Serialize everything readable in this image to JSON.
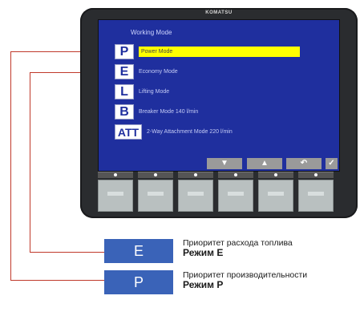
{
  "monitor": {
    "brand": "KOMATSU",
    "screen_title": "Working Mode",
    "modes": [
      {
        "key": "P",
        "label": "Power Mode",
        "selected": true
      },
      {
        "key": "E",
        "label": "Economy Mode",
        "selected": false
      },
      {
        "key": "L",
        "label": "Lifting Mode",
        "selected": false
      },
      {
        "key": "B",
        "label": "Breaker Mode  140 l/min",
        "selected": false
      },
      {
        "key": "ATT",
        "label": "2-Way Attachment Mode  220 l/min",
        "selected": false
      }
    ],
    "nav_buttons": [
      {
        "icon": "arrow-down-icon",
        "glyph": "▼"
      },
      {
        "icon": "arrow-up-icon",
        "glyph": "▲"
      },
      {
        "icon": "return-icon",
        "glyph": "↶"
      },
      {
        "icon": "confirm-icon",
        "glyph": "✓"
      }
    ]
  },
  "legend": {
    "economy": {
      "badge": "E",
      "subtitle": "Приоритет расхода топлива",
      "title": "Режим E"
    },
    "power": {
      "badge": "P",
      "subtitle": "Приоритет производительности",
      "title": "Режим P"
    }
  },
  "colors": {
    "screen": "#1f2f9e",
    "highlight": "#ffff00",
    "leader": "#c0392b",
    "badge": "#3a63b8"
  }
}
